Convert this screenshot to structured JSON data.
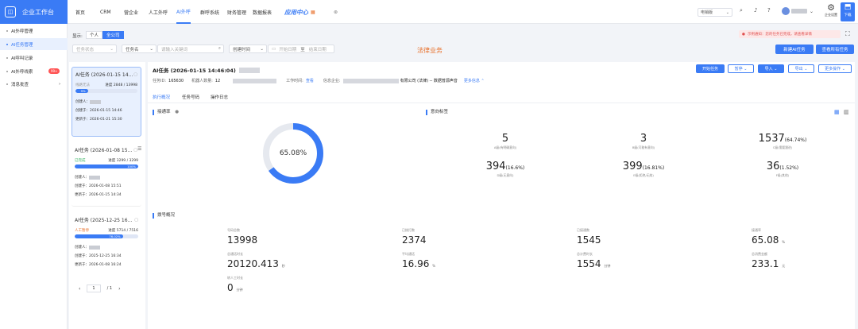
{
  "brand": {
    "title": "企业工作台"
  },
  "nav": [
    "首页",
    "CRM",
    "营企业",
    "人工外呼",
    "AI外呼",
    "群呼系统",
    "财务管理",
    "数据报表"
  ],
  "header": {
    "promo_label": "应用中心",
    "search_placeholder": "电销版",
    "user_name": "",
    "help_label": "企业设置",
    "download_label": "下载"
  },
  "sidebar": {
    "items": [
      {
        "label": "AI外呼管理"
      },
      {
        "label": "AI任务管理"
      },
      {
        "label": "AI呼叫记录"
      },
      {
        "label": "AI外呼线索",
        "badge": "99+"
      },
      {
        "label": "消息批查"
      }
    ]
  },
  "filters": {
    "display_label": "显示:",
    "toggle_personal": "个人",
    "toggle_company": "全公司",
    "status_placeholder": "任务状态",
    "name_select": "任务名",
    "keyword_placeholder": "请输入关键词",
    "time_select": "创建时间",
    "start_date": "开始日期",
    "date_sep": "至",
    "end_date": "结束日期",
    "business_label": "法律业务",
    "warn_text": "示例通知：您的任务已完成，请查看详情",
    "new_task_btn": "新建AI任务",
    "view_all_btn": "查看所有任务"
  },
  "tasks": [
    {
      "title": "AI任务 (2026-01-15 14...",
      "status": "线路无法",
      "progress": "进度 2848 / 13998",
      "percent_label": "9%",
      "percent": 20,
      "creator": "",
      "created": "2026-01-15 14:46",
      "updated": "2026-01-21 15:30"
    },
    {
      "title": "AI任务 (2026-01-08 15...",
      "status": "已完成",
      "progress": "进度 3299 / 3299",
      "percent_label": "100%",
      "percent": 100,
      "creator": "",
      "created": "2026-01-08 15:51",
      "updated": "2026-01-15 14:34"
    },
    {
      "title": "AI任务 (2025-12-25 16...",
      "status": "人工暂停",
      "progress": "进度 5714 / 7516",
      "percent_label": "76.02%",
      "percent": 76,
      "creator": "",
      "created": "2025-12-25 16:34",
      "updated": "2026-01-08 16:24"
    }
  ],
  "pagination": {
    "page": "1",
    "total": "/ 1"
  },
  "detail": {
    "title": "AI任务 (2026-01-15 14:46:04)",
    "task_id_label": "任务ID:",
    "task_id": "165630",
    "robot_label": "机器人数量:",
    "robot_count": "12",
    "worktime_label": "工作时间:",
    "worktime_link": "查看",
    "company_label": "信息企业:",
    "company_name": "有限公司 (法律) -- 数据普源声音",
    "more_link": "更多信息",
    "buttons": [
      "开始任务",
      "暂停",
      "导入",
      "导出",
      "更多操作"
    ]
  },
  "tabs": [
    "执行概况",
    "任务号码",
    "操作日志"
  ],
  "connect": {
    "title": "接通率",
    "rate": "65.08%",
    "rate_value": 65.08,
    "intent_title": "意向标签",
    "stats": [
      {
        "value": "5",
        "suffix": "",
        "label": "A级(有明确意向)"
      },
      {
        "value": "3",
        "suffix": "",
        "label": "B级(可能有意向)"
      },
      {
        "value": "1537",
        "suffix": "(64.74%)",
        "label": "C级(需要跟进)"
      },
      {
        "value": "394",
        "suffix": "(16.6%)",
        "label": "D级(无意向)"
      },
      {
        "value": "399",
        "suffix": "(16.81%)",
        "label": "E级(拒绝/无效)"
      },
      {
        "value": "36",
        "suffix": "(1.52%)",
        "label": "F级(其他)"
      }
    ]
  },
  "overview": {
    "title": "拨号概况",
    "kpis": [
      {
        "label": "号码总数",
        "value": "13998",
        "unit": ""
      },
      {
        "label": "已拨打数",
        "value": "2374",
        "unit": ""
      },
      {
        "label": "已接通数",
        "value": "1545",
        "unit": ""
      },
      {
        "label": "接通率",
        "value": "65.08",
        "unit": "%"
      },
      {
        "label": "总通话时长",
        "value": "20120.413",
        "unit": "秒"
      },
      {
        "label": "平均通话",
        "value": "16.96",
        "unit": "%"
      },
      {
        "label": "总计费时长",
        "value": "1554",
        "unit": "分钟"
      },
      {
        "label": "总消费金额",
        "value": "233.1",
        "unit": "元"
      },
      {
        "label": "转人工时长",
        "value": "0",
        "unit": "分钟"
      }
    ]
  },
  "colors": {
    "accent": "#3a7bf5",
    "ring_track": "#e6e9ef"
  }
}
